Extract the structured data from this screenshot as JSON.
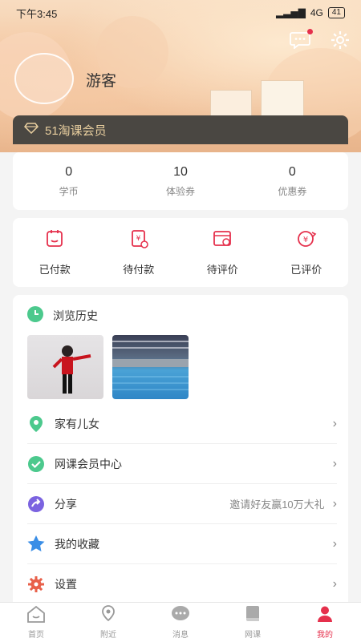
{
  "status_bar": {
    "time": "下午3:45",
    "network": "4G",
    "battery": "41"
  },
  "profile": {
    "username": "游客"
  },
  "vip": {
    "label": "51淘课会员"
  },
  "stats": [
    {
      "value": "0",
      "label": "学币"
    },
    {
      "value": "10",
      "label": "体验券"
    },
    {
      "value": "0",
      "label": "优惠券"
    }
  ],
  "orders": [
    {
      "label": "已付款",
      "icon": "paid-icon"
    },
    {
      "label": "待付款",
      "icon": "pending-payment-icon"
    },
    {
      "label": "待评价",
      "icon": "pending-review-icon"
    },
    {
      "label": "已评价",
      "icon": "reviewed-icon"
    }
  ],
  "history": {
    "title": "浏览历史"
  },
  "menu": [
    {
      "label": "家有儿女",
      "icon": "location-pin-icon",
      "extra": ""
    },
    {
      "label": "网课会员中心",
      "icon": "check-circle-icon",
      "extra": ""
    },
    {
      "label": "分享",
      "icon": "share-icon",
      "extra": "邀请好友赢10万大礼"
    },
    {
      "label": "我的收藏",
      "icon": "star-icon",
      "extra": ""
    },
    {
      "label": "设置",
      "icon": "gear-icon",
      "extra": ""
    }
  ],
  "tabs": [
    {
      "label": "首页",
      "icon": "home-icon"
    },
    {
      "label": "附近",
      "icon": "map-pin-icon"
    },
    {
      "label": "消息",
      "icon": "message-icon"
    },
    {
      "label": "网课",
      "icon": "book-icon"
    },
    {
      "label": "我的",
      "icon": "user-icon"
    }
  ],
  "colors": {
    "accent": "#e5304c",
    "vip_bg": "#4a4742",
    "vip_text": "#e9cf9f",
    "green": "#4cc98d",
    "star": "#3a8ee6"
  }
}
